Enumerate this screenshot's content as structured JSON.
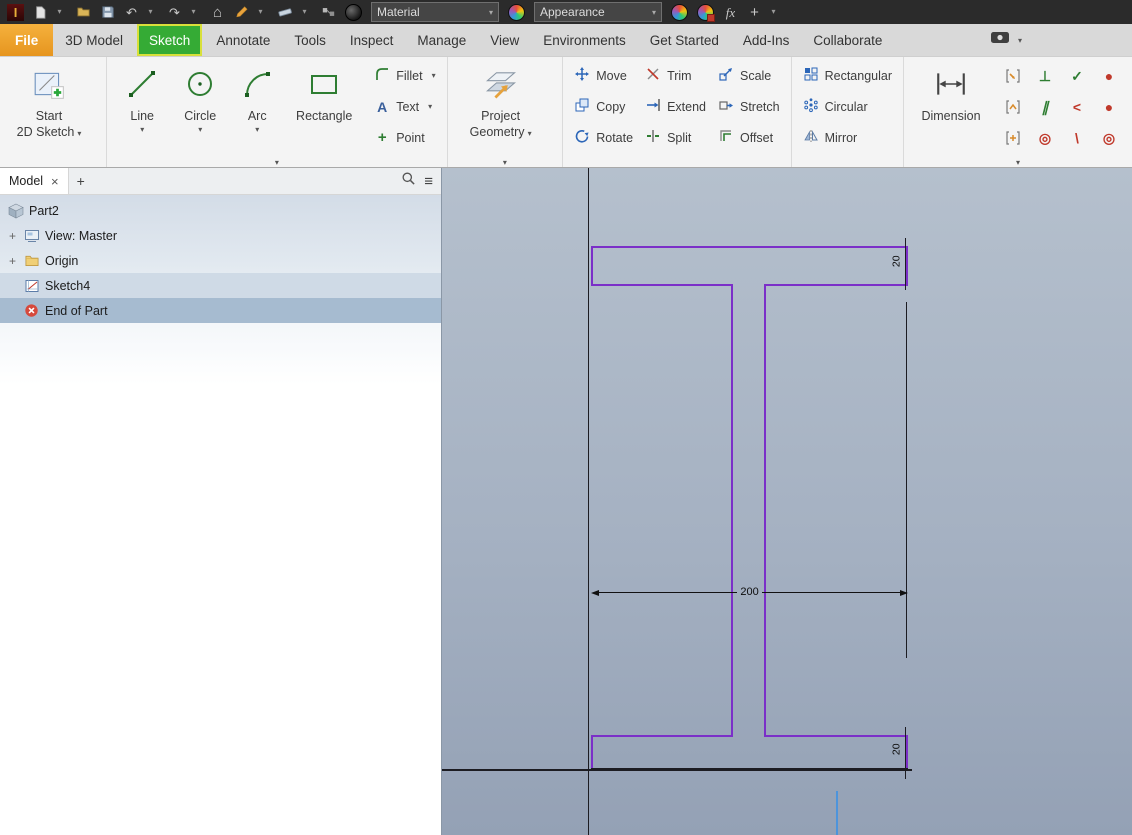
{
  "titlebar": {
    "app_initial": "I",
    "material": "Material",
    "appearance": "Appearance",
    "fx": "fx"
  },
  "glyphs": {
    "caret": "▾",
    "plus": "+",
    "close": "×",
    "menu": "≡",
    "undo": "↶",
    "redo": "↷",
    "home": "⌂",
    "letter_a": "A",
    "perpendicular": "⊥",
    "parallel": "∥",
    "concentric": "◎",
    "check": "✓",
    "angle": "<",
    "backslash": "\\",
    "dot": "●"
  },
  "tabs": {
    "items": [
      "File",
      "3D Model",
      "Sketch",
      "Annotate",
      "Tools",
      "Inspect",
      "Manage",
      "View",
      "Environments",
      "Get Started",
      "Add-Ins",
      "Collaborate"
    ],
    "active": "Sketch"
  },
  "ribbon": {
    "start_sketch_line1": "Start",
    "start_sketch_line2": "2D Sketch",
    "line": "Line",
    "circle": "Circle",
    "arc": "Arc",
    "rectangle": "Rectangle",
    "fillet": "Fillet",
    "text": "Text",
    "point": "Point",
    "project_line1": "Project",
    "project_line2": "Geometry",
    "move": "Move",
    "copy": "Copy",
    "rotate": "Rotate",
    "trim": "Trim",
    "extend": "Extend",
    "split": "Split",
    "scale": "Scale",
    "stretch": "Stretch",
    "offset": "Offset",
    "rectangular": "Rectangular",
    "circular": "Circular",
    "mirror": "Mirror",
    "dimension": "Dimension"
  },
  "browser": {
    "tab": "Model",
    "tree": [
      {
        "label": "Part2"
      },
      {
        "label": "View: Master"
      },
      {
        "label": "Origin"
      },
      {
        "label": "Sketch4"
      },
      {
        "label": "End of Part"
      }
    ]
  },
  "viewport": {
    "dim_width": "200",
    "dim_flange_top": "20",
    "dim_flange_bottom": "20"
  },
  "colors": {
    "sketch_purple": "#7b2fc8",
    "file_tab_orange": "#e6951f",
    "sketch_tab_highlight_green": "#35ab35",
    "highlight_border_yellow": "#d8e03a",
    "selected_row": "#cfdae6",
    "end_of_part_row": "#a6bbd0",
    "viewport_gradient_top": "#b5c0cd",
    "viewport_gradient_bottom": "#94a1b5",
    "axis_line": "#1c1c22",
    "aux_blue_line": "#4d94db"
  }
}
